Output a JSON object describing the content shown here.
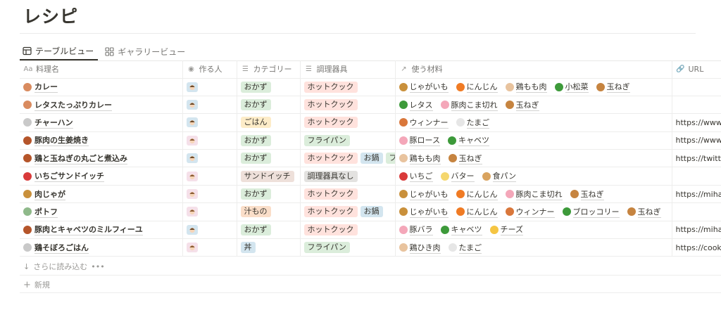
{
  "page": {
    "title": "レシピ"
  },
  "tabs": [
    {
      "label": "テーブルビュー",
      "icon": "table-icon",
      "active": true
    },
    {
      "label": "ギャラリービュー",
      "icon": "gallery-icon",
      "active": false
    }
  ],
  "columns": [
    {
      "label": "料理名",
      "icon": "Aa"
    },
    {
      "label": "作る人",
      "icon": "◉"
    },
    {
      "label": "カテゴリー",
      "icon": "☰"
    },
    {
      "label": "調理器具",
      "icon": "☰"
    },
    {
      "label": "使う材料",
      "icon": "↗"
    },
    {
      "label": "URL",
      "icon": "🔗"
    }
  ],
  "rows": [
    {
      "name": "カレー",
      "icon_color": "#d98b5f",
      "person": "boy",
      "category": {
        "label": "おかず",
        "color": "#dbeddb"
      },
      "tools": [
        {
          "label": "ホットクック",
          "color": "#ffe2dd"
        }
      ],
      "materials": [
        {
          "label": "じゃがいも",
          "color": "#c9903b"
        },
        {
          "label": "にんじん",
          "color": "#f07b24"
        },
        {
          "label": "鶏もも肉",
          "color": "#e8c39e"
        },
        {
          "label": "小松菜",
          "color": "#3d9a3a"
        },
        {
          "label": "玉ねぎ",
          "color": "#c68440"
        }
      ],
      "url": ""
    },
    {
      "name": "レタスたっぷりカレー",
      "icon_color": "#d98b5f",
      "person": "boy",
      "category": {
        "label": "おかず",
        "color": "#dbeddb"
      },
      "tools": [
        {
          "label": "ホットクック",
          "color": "#ffe2dd"
        }
      ],
      "materials": [
        {
          "label": "レタス",
          "color": "#3d9a3a"
        },
        {
          "label": "豚肉こま切れ",
          "color": "#f4a7b9"
        },
        {
          "label": "玉ねぎ",
          "color": "#c68440"
        }
      ],
      "url": ""
    },
    {
      "name": "チャーハン",
      "icon_color": "#c9c9c9",
      "person": "boy",
      "category": {
        "label": "ごはん",
        "color": "#fdecc8"
      },
      "tools": [
        {
          "label": "ホットクック",
          "color": "#ffe2dd"
        }
      ],
      "materials": [
        {
          "label": "ウィンナー",
          "color": "#d9773b"
        },
        {
          "label": "たまご",
          "color": "#e6e6e6"
        }
      ],
      "url": "https://www.y"
    },
    {
      "name": "豚肉の生姜焼き",
      "icon_color": "#b5552a",
      "person": "girl",
      "category": {
        "label": "おかず",
        "color": "#dbeddb"
      },
      "tools": [
        {
          "label": "フライパン",
          "color": "#dbeddb"
        }
      ],
      "materials": [
        {
          "label": "豚ロース",
          "color": "#f4a7b9"
        },
        {
          "label": "キャベツ",
          "color": "#3d9a3a"
        }
      ],
      "url": "https://www.k"
    },
    {
      "name": "鶏と玉ねぎの丸ごと煮込み",
      "icon_color": "#b5552a",
      "person": "boy",
      "category": {
        "label": "おかず",
        "color": "#dbeddb"
      },
      "tools": [
        {
          "label": "ホットクック",
          "color": "#ffe2dd"
        },
        {
          "label": "お鍋",
          "color": "#d3e5ef"
        },
        {
          "label": "フ",
          "color": "#dbeddb"
        }
      ],
      "materials": [
        {
          "label": "鶏もも肉",
          "color": "#e8c39e"
        },
        {
          "label": "玉ねぎ",
          "color": "#c68440"
        }
      ],
      "url": "https://twitte"
    },
    {
      "name": "いちごサンドイッチ",
      "icon_color": "#d93a3a",
      "person": "girl",
      "category": {
        "label": "サンドイッチ",
        "color": "#eee0da"
      },
      "tools": [
        {
          "label": "調理器具なし",
          "color": "#e3e2e0"
        }
      ],
      "materials": [
        {
          "label": "いちご",
          "color": "#d93a3a"
        },
        {
          "label": "バター",
          "color": "#f5d76e"
        },
        {
          "label": "食パン",
          "color": "#d9a35f"
        }
      ],
      "url": ""
    },
    {
      "name": "肉じゃが",
      "icon_color": "#c9903b",
      "person": "girl",
      "category": {
        "label": "おかず",
        "color": "#dbeddb"
      },
      "tools": [
        {
          "label": "ホットクック",
          "color": "#ffe2dd"
        }
      ],
      "materials": [
        {
          "label": "じゃがいも",
          "color": "#c9903b"
        },
        {
          "label": "にんじん",
          "color": "#f07b24"
        },
        {
          "label": "豚肉こま切れ",
          "color": "#f4a7b9"
        },
        {
          "label": "玉ねぎ",
          "color": "#c68440"
        }
      ],
      "url": "https://mihar"
    },
    {
      "name": "ポトフ",
      "icon_color": "#8fb98a",
      "person": "girl",
      "category": {
        "label": "汁もの",
        "color": "#fadec9"
      },
      "tools": [
        {
          "label": "ホットクック",
          "color": "#ffe2dd"
        },
        {
          "label": "お鍋",
          "color": "#d3e5ef"
        }
      ],
      "materials": [
        {
          "label": "じゃがいも",
          "color": "#c9903b"
        },
        {
          "label": "にんじん",
          "color": "#f07b24"
        },
        {
          "label": "ウィンナー",
          "color": "#d9773b"
        },
        {
          "label": "ブロッコリー",
          "color": "#3d9a3a"
        },
        {
          "label": "玉ねぎ",
          "color": "#c68440"
        }
      ],
      "url": ""
    },
    {
      "name": "豚肉とキャベツのミルフィーユ",
      "icon_color": "#b5552a",
      "person": "boy",
      "category": {
        "label": "おかず",
        "color": "#dbeddb"
      },
      "tools": [
        {
          "label": "ホットクック",
          "color": "#ffe2dd"
        }
      ],
      "materials": [
        {
          "label": "豚バラ",
          "color": "#f4a7b9"
        },
        {
          "label": "キャベツ",
          "color": "#3d9a3a"
        },
        {
          "label": "チーズ",
          "color": "#f5c542"
        }
      ],
      "url": "https://mihar"
    },
    {
      "name": "鶏そぼろごはん",
      "icon_color": "#c9c9c9",
      "person": "girl",
      "category": {
        "label": "丼",
        "color": "#d3e5ef"
      },
      "tools": [
        {
          "label": "フライパン",
          "color": "#dbeddb"
        }
      ],
      "materials": [
        {
          "label": "鶏ひき肉",
          "color": "#e8c39e"
        },
        {
          "label": "たまご",
          "color": "#e6e6e6"
        }
      ],
      "url": "https://cookp"
    }
  ],
  "footer": {
    "load_more": "さらに読み込む",
    "load_more_dots": "•••",
    "new_row": "新規",
    "load_more_icon": "↓",
    "new_row_icon": "+"
  }
}
